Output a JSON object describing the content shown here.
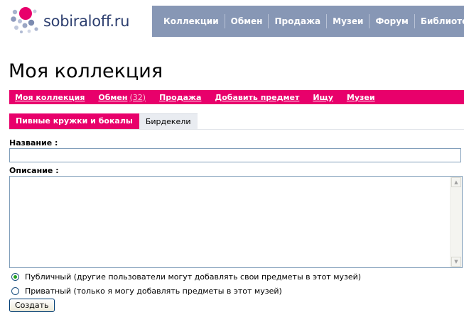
{
  "brand": {
    "name": "sobiraloff",
    "tld": ".ru",
    "accent": "#e8006b",
    "nav_bg": "#8797b5"
  },
  "topnav": [
    "Коллекции",
    "Обмен",
    "Продажа",
    "Музеи",
    "Форум",
    "Библиотека"
  ],
  "page_title": "Моя коллекция",
  "subnav": {
    "my_collection": "Моя коллекция",
    "exchange": "Обмен",
    "exchange_count": "(32)",
    "sale": "Продажа",
    "add_item": "Добавить предмет",
    "looking_for": "Ищу",
    "museums": "Музеи"
  },
  "tabs": {
    "active": "Пивные кружки и бокалы",
    "other": "Бирдекели"
  },
  "form": {
    "name_label": "Название :",
    "name_value": "",
    "description_label": "Описание :",
    "description_value": "",
    "public_label": "Публичный (другие пользователи могут добавлять свои предметы в этот музей)",
    "private_label": "Приватный (только я могу добавлять предметы в этот музей)",
    "submit": "Создать"
  }
}
